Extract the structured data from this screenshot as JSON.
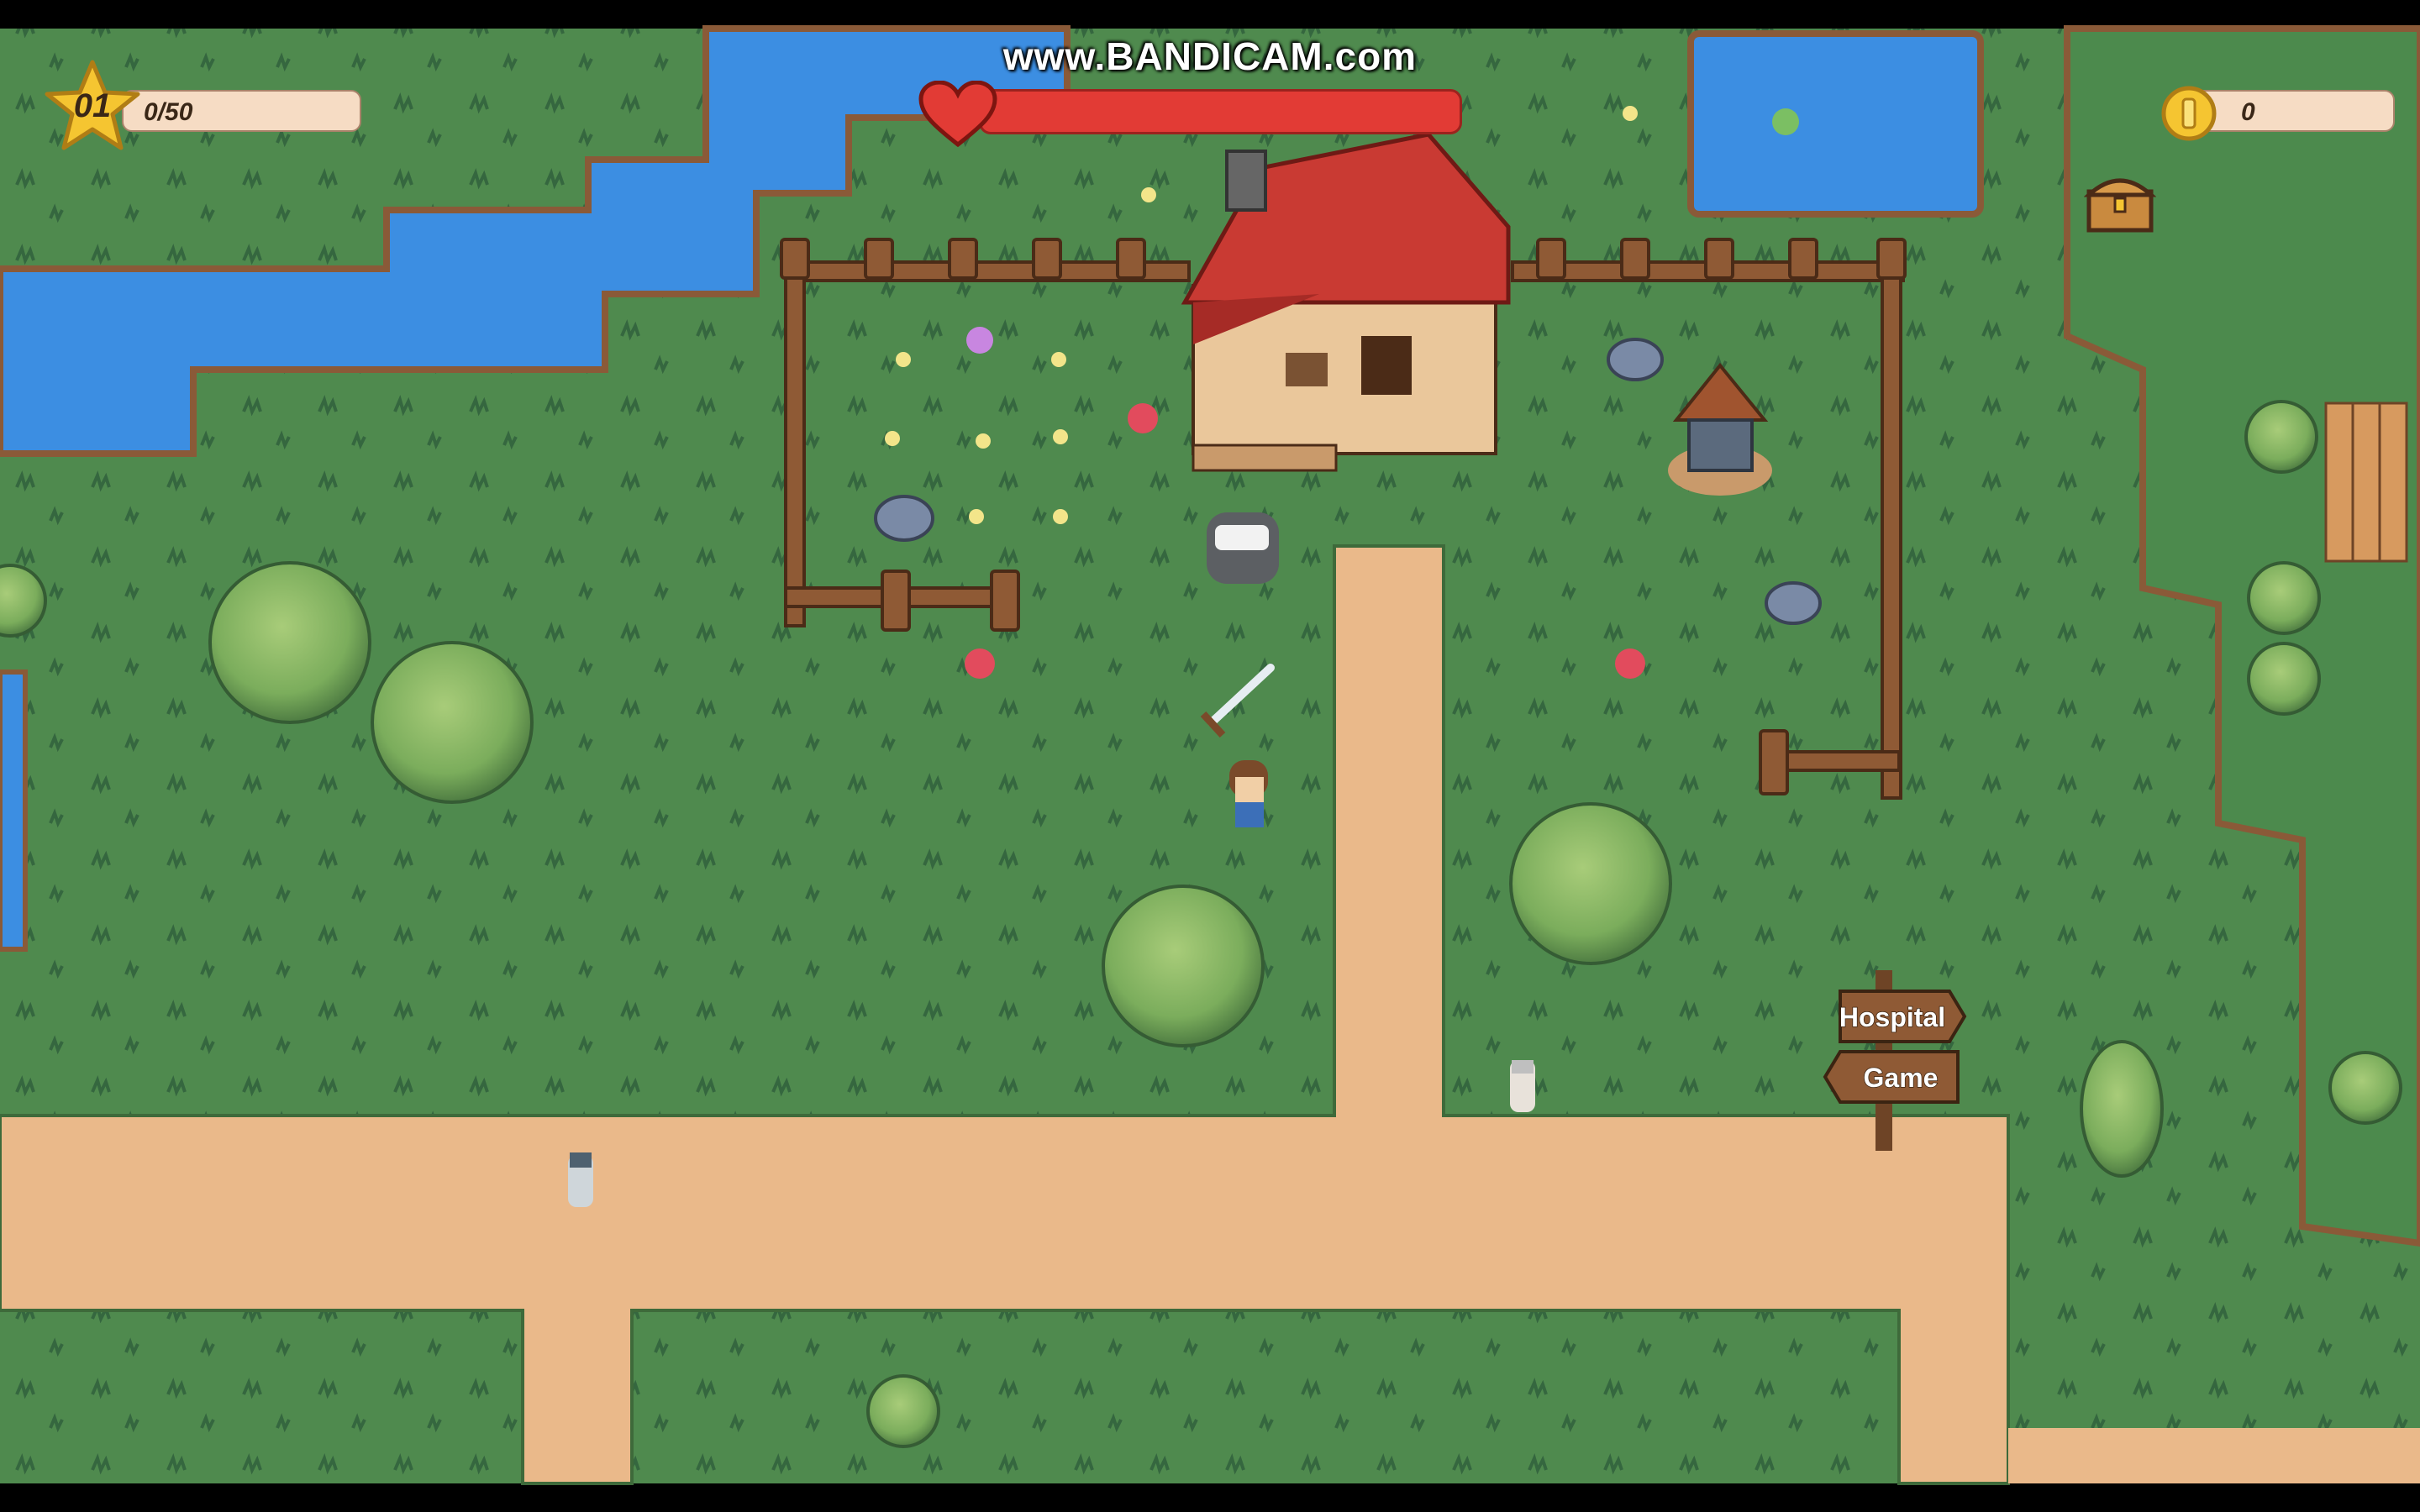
{
  "watermark": "www.BANDICAM.com",
  "hud": {
    "level": "01",
    "xp": "0/50",
    "health_fraction": 1.0,
    "coins": "0"
  },
  "signpost": {
    "labels": [
      "Hospital",
      "Game"
    ]
  },
  "icons": {
    "level": "star-icon",
    "health": "heart-icon",
    "currency": "coin-icon",
    "inventory": "treasure-chest-icon"
  },
  "colors": {
    "grass": "#4f8a4e",
    "water": "#3c8ee2",
    "dirt_path": "#eab98a",
    "roof": "#c93a33",
    "health_bar": "#e23b35",
    "letterbox": "#000000"
  }
}
